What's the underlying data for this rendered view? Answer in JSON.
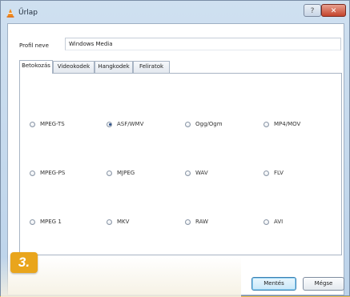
{
  "window": {
    "title": "Űrlap",
    "help_label": "?",
    "close_label": "✕"
  },
  "profile": {
    "label": "Profil neve",
    "value": "Windows Media"
  },
  "tabs": [
    {
      "label": "Betokozás",
      "active": true
    },
    {
      "label": "Videokodek",
      "active": false
    },
    {
      "label": "Hangkodek",
      "active": false
    },
    {
      "label": "Feliratok",
      "active": false
    }
  ],
  "encapsulation_options": [
    {
      "label": "MPEG-TS",
      "checked": false
    },
    {
      "label": "ASF/WMV",
      "checked": true
    },
    {
      "label": "Ogg/Ogm",
      "checked": false
    },
    {
      "label": "MP4/MOV",
      "checked": false
    },
    {
      "label": "MPEG-PS",
      "checked": false
    },
    {
      "label": "MJPEG",
      "checked": false
    },
    {
      "label": "WAV",
      "checked": false
    },
    {
      "label": "FLV",
      "checked": false
    },
    {
      "label": "MPEG 1",
      "checked": false
    },
    {
      "label": "MKV",
      "checked": false
    },
    {
      "label": "RAW",
      "checked": false
    },
    {
      "label": "AVI",
      "checked": false
    }
  ],
  "buttons": {
    "save_label": "Mentés",
    "cancel_label": "Mégse"
  },
  "step_badge": "3.",
  "colors": {
    "accent_orange": "#e9a51c",
    "frame_blue": "#bcd3ea"
  }
}
